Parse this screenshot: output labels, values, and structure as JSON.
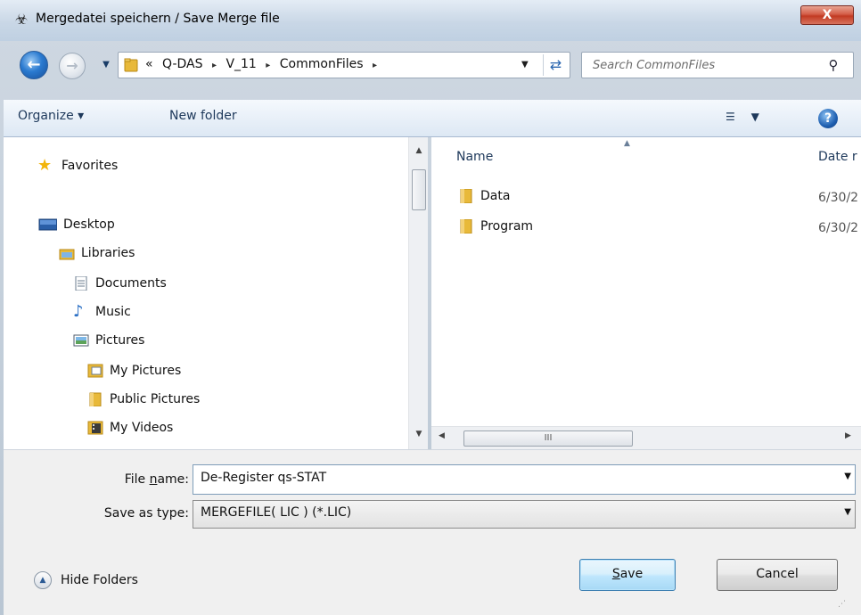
{
  "window": {
    "title": "Mergedatei speichern / Save Merge file",
    "close_label": "X"
  },
  "address": {
    "overflow": "«",
    "crumbs": [
      "Q-DAS",
      "V_11",
      "CommonFiles"
    ],
    "separator": "▸"
  },
  "search": {
    "placeholder": "Search CommonFiles"
  },
  "toolbar": {
    "organize_label": "Organize ▾",
    "new_folder_label": "New folder",
    "help_label": "?"
  },
  "nav": {
    "favorites": "Favorites",
    "desktop": "Desktop",
    "libraries": "Libraries",
    "documents": "Documents",
    "music": "Music",
    "pictures": "Pictures",
    "my_pictures": "My Pictures",
    "public_pictures": "Public Pictures",
    "my_videos": "My Videos"
  },
  "columns": {
    "name": "Name",
    "date": "Date r"
  },
  "files": [
    {
      "name": "Data",
      "date": "6/30/2"
    },
    {
      "name": "Program",
      "date": "6/30/2"
    }
  ],
  "hscroll_grip": "III",
  "form": {
    "filename_label_pre": "File ",
    "filename_label_accel": "n",
    "filename_label_post": "ame:",
    "filename_value": "De-Register qs-STAT",
    "savetype_label": "Save as type:",
    "savetype_value": "MERGEFILE( LIC ) (*.LIC)"
  },
  "buttons": {
    "hide_folders": "Hide Folders",
    "save_accel": "S",
    "save_rest": "ave",
    "cancel": "Cancel"
  },
  "colors": {
    "accent": "#3c7fb1",
    "toolbar_text": "#1e395b",
    "close_red": "#c23a22"
  }
}
